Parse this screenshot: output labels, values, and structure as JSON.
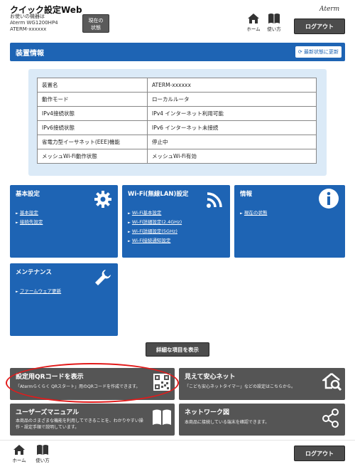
{
  "header": {
    "title": "クイック設定Web",
    "device_label": "お使いの機器は",
    "device_model": "Aterm WG1200HP4",
    "device_name": "ATERM-xxxxxx",
    "status_button_line1": "現在の",
    "status_button_line2": "状態",
    "home_label": "ホーム",
    "manual_label": "使い方",
    "brand": "Aterm",
    "logout_label": "ログアウト"
  },
  "device_info": {
    "title": "装置情報",
    "refresh_label": "最新状態に更新",
    "rows": [
      {
        "key": "装置名",
        "value": "ATERM-xxxxxx"
      },
      {
        "key": "動作モード",
        "value": "ローカルルータ"
      },
      {
        "key": "IPv4接続状態",
        "value": "IPv4 インターネット利用可能"
      },
      {
        "key": "IPv6接続状態",
        "value": "IPv6 インターネット未接続"
      },
      {
        "key": "省電力型イーサネット(EEE)機能",
        "value": "停止中"
      },
      {
        "key": "メッシュWi-Fi動作状態",
        "value": "メッシュWi-Fi有効"
      }
    ]
  },
  "cards": {
    "basic": {
      "title": "基本設定",
      "links": [
        "基本設定",
        "接続先設定"
      ],
      "icon": "gear-icon"
    },
    "wifi": {
      "title": "Wi-Fi(無線LAN)設定",
      "links": [
        "Wi-Fi基本設定",
        "Wi-Fi詳細設定(2.4GHz)",
        "Wi-Fi詳細設定(5GHz)",
        "Wi-Fi接続通知設定"
      ],
      "icon": "wifi-icon"
    },
    "info": {
      "title": "情報",
      "links": [
        "現在の状態"
      ],
      "icon": "info-icon"
    },
    "maintenance": {
      "title": "メンテナンス",
      "links": [
        "ファームウェア更新"
      ],
      "icon": "wrench-icon"
    }
  },
  "detail_button_label": "詳細な項目を表示",
  "bottom_cards": {
    "qr": {
      "title": "設定用QRコードを表示",
      "desc": "「Atermらくらく QRスタート」用のQRコードを作成できます。",
      "icon": "qr-code-icon"
    },
    "safety": {
      "title": "見えて安心ネット",
      "desc": "「こども安心ネットタイマー」などの設定はこちらから。",
      "icon": "house-search-icon"
    },
    "manual": {
      "title": "ユーザーズマニュアル",
      "desc1": "本商品のさまざまな機能を利用してできることを、わかりやすい操",
      "desc2": "作・設定手順で説明しています。",
      "icon": "book-icon"
    },
    "network": {
      "title": "ネットワーク図",
      "desc": "本商品に接続している端末を確認できます。",
      "icon": "network-icon"
    }
  },
  "footer": {
    "home_label": "ホーム",
    "manual_label": "使い方",
    "logout_label": "ログアウト"
  },
  "colors": {
    "primary": "#1e64b4",
    "dark": "#4c4c4c",
    "gray_card": "#555555",
    "panel": "#dbeaf7",
    "highlight": "#e21b1b"
  }
}
